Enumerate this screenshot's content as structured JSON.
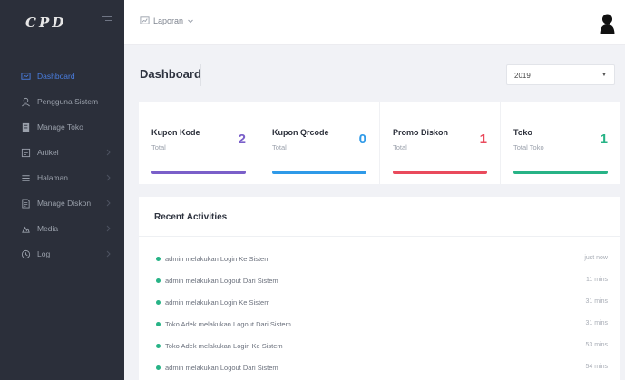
{
  "brand": {
    "logo": "CPD"
  },
  "sidebar": {
    "items": [
      {
        "label": "Dashboard",
        "icon": "dashboard-icon",
        "active": true,
        "has_arrow": false
      },
      {
        "label": "Pengguna Sistem",
        "icon": "user-icon",
        "active": false,
        "has_arrow": false
      },
      {
        "label": "Manage Toko",
        "icon": "store-icon",
        "active": false,
        "has_arrow": false
      },
      {
        "label": "Artikel",
        "icon": "article-icon",
        "active": false,
        "has_arrow": true
      },
      {
        "label": "Halaman",
        "icon": "page-icon",
        "active": false,
        "has_arrow": true
      },
      {
        "label": "Manage Diskon",
        "icon": "discount-icon",
        "active": false,
        "has_arrow": true
      },
      {
        "label": "Media",
        "icon": "media-icon",
        "active": false,
        "has_arrow": true
      },
      {
        "label": "Log",
        "icon": "log-icon",
        "active": false,
        "has_arrow": true
      }
    ]
  },
  "header": {
    "report_menu_label": "Laporan"
  },
  "page": {
    "title": "Dashboard",
    "year_selected": "2019"
  },
  "stats": [
    {
      "title": "Kupon Kode",
      "sub": "Total",
      "value": "2",
      "color": "#7a5fc9"
    },
    {
      "title": "Kupon Qrcode",
      "sub": "Total",
      "value": "0",
      "color": "#2f9ae8"
    },
    {
      "title": "Promo Diskon",
      "sub": "Total",
      "value": "1",
      "color": "#e94a5c"
    },
    {
      "title": "Toko",
      "sub": "Total Toko",
      "value": "1",
      "color": "#27b386"
    }
  ],
  "activities": {
    "title": "Recent Activities",
    "items": [
      {
        "text": "admin melakukan Login Ke Sistem",
        "time": "just now"
      },
      {
        "text": "admin melakukan Logout Dari Sistem",
        "time": "11 mins"
      },
      {
        "text": "admin melakukan Login Ke Sistem",
        "time": "31 mins"
      },
      {
        "text": "Toko Adek melakukan Logout Dari Sistem",
        "time": "31 mins"
      },
      {
        "text": "Toko Adek melakukan Login Ke Sistem",
        "time": "53 mins"
      },
      {
        "text": "admin melakukan Logout Dari Sistem",
        "time": "54 mins"
      }
    ]
  }
}
